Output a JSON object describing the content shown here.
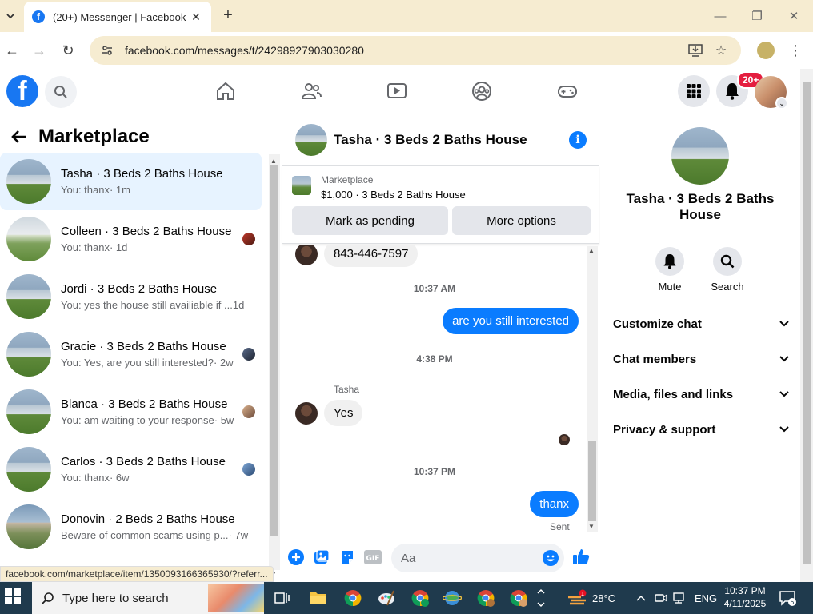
{
  "browser": {
    "tab_title": "(20+) Messenger | Facebook",
    "url": "facebook.com/messages/t/24298927903030280",
    "status_url": "facebook.com/marketplace/item/1350093166365930/?referr..."
  },
  "fb_nav": {
    "notification_badge": "20+",
    "icons": [
      "home-icon",
      "friends-icon",
      "watch-icon",
      "groups-icon",
      "gaming-icon"
    ]
  },
  "left": {
    "title": "Marketplace",
    "conversations": [
      {
        "name": "Tasha · 3 Beds 2 Baths House",
        "preview": "You: thanx",
        "time": "· 1m",
        "active": true
      },
      {
        "name": "Colleen · 3 Beds 2 Baths House",
        "preview": "You: thanx",
        "time": "· 1d"
      },
      {
        "name": "Jordi · 3 Beds 2 Baths House",
        "preview": "You: yes the house still availiable if ...",
        "time": " 1d"
      },
      {
        "name": "Gracie · 3 Beds 2 Baths House",
        "preview": "You: Yes, are you still interested?",
        "time": " · 2w"
      },
      {
        "name": "Blanca · 3 Beds 2 Baths House",
        "preview": "You: am waiting to your response",
        "time": " · 5w"
      },
      {
        "name": "Carlos · 3 Beds 2 Baths House",
        "preview": "You: thanx",
        "time": " · 6w"
      },
      {
        "name": "Donovin · 2 Beds 2 Baths House",
        "preview": "Beware of common scams using p...",
        "time": " · 7w"
      }
    ]
  },
  "chat": {
    "title": "Tasha · 3 Beds 2 Baths House",
    "marketplace_label": "Marketplace",
    "listing": "$1,000 · 3 Beds 2 Baths House",
    "mark_pending": "Mark as pending",
    "more_options": "More options",
    "messages": {
      "phone": "843-446-7597",
      "ts1": "10:37 AM",
      "out1": "are you still interested",
      "ts2": "4:38 PM",
      "sender": "Tasha",
      "in1": "Yes",
      "ts3": "10:37 PM",
      "out2": "thanx",
      "sent": "Sent"
    },
    "composer_placeholder": "Aa"
  },
  "info": {
    "name": "Tasha · 3 Beds 2 Baths House",
    "mute": "Mute",
    "search": "Search",
    "sections": [
      "Customize chat",
      "Chat members",
      "Media, files and links",
      "Privacy & support"
    ]
  },
  "taskbar": {
    "search": "Type here to search",
    "weather": "28°C",
    "lang": "ENG",
    "time": "10:37 PM",
    "date": "4/11/2025",
    "notif_count": "5"
  },
  "colors": {
    "fb_blue": "#1877f2",
    "messenger_blue": "#0a7cff",
    "active_row": "#e7f3ff"
  }
}
